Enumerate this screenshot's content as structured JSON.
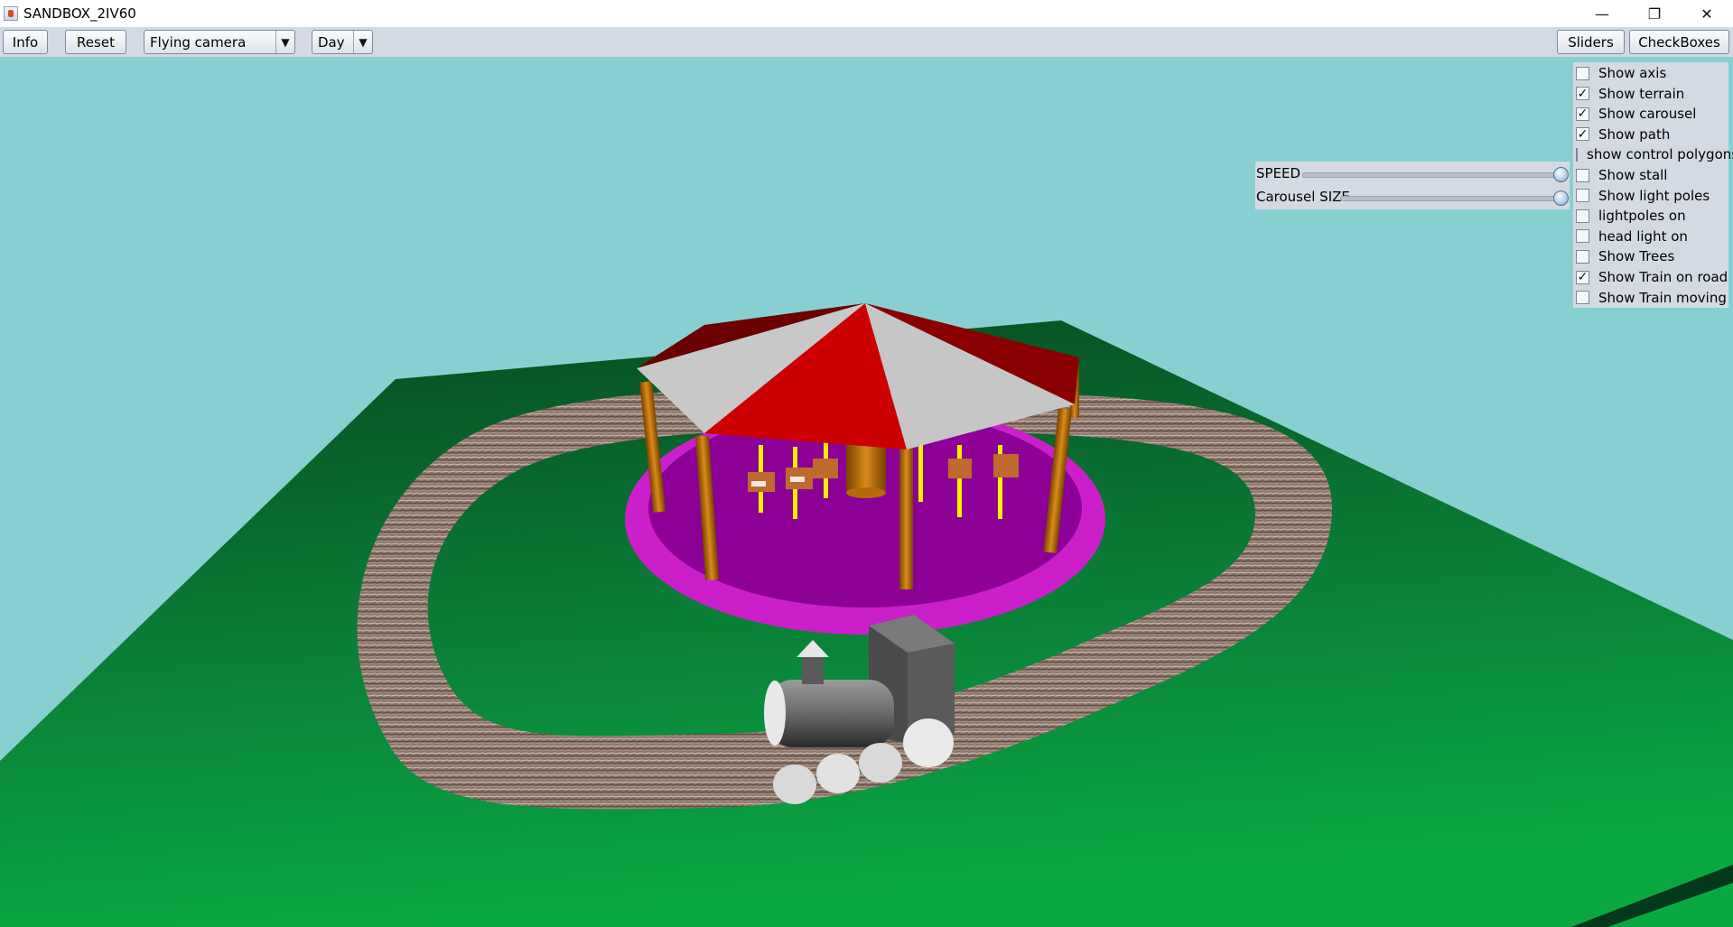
{
  "window": {
    "title": "SANDBOX_2IV60",
    "minimize_glyph": "—",
    "maximize_glyph": "❐",
    "close_glyph": "✕"
  },
  "toolbar": {
    "info_label": "Info",
    "reset_label": "Reset",
    "camera_mode": "Flying camera",
    "time_of_day": "Day",
    "sliders_label": "Sliders",
    "checkboxes_label": "CheckBoxes",
    "dropdown_arrow": "▼"
  },
  "sliders": [
    {
      "label": "SPEED",
      "value": 1.0
    },
    {
      "label": "Carousel SIZE",
      "value": 1.0
    }
  ],
  "checkboxes": [
    {
      "label": "Show axis",
      "checked": false
    },
    {
      "label": "Show terrain",
      "checked": true
    },
    {
      "label": "Show carousel",
      "checked": true
    },
    {
      "label": "Show path",
      "checked": true
    },
    {
      "label": "show control polygons",
      "checked": false
    },
    {
      "label": "Show stall",
      "checked": false
    },
    {
      "label": "Show light poles",
      "checked": false
    },
    {
      "label": "lightpoles on",
      "checked": false
    },
    {
      "label": "head light on",
      "checked": false
    },
    {
      "label": "Show Trees",
      "checked": false
    },
    {
      "label": "Show Train on road",
      "checked": true
    },
    {
      "label": "Show Train moving",
      "checked": false
    }
  ],
  "check_glyph": "✓",
  "colors": {
    "sky": "#87cfd1",
    "terrain": "#0b8a3a",
    "carousel_base": "#cc1fcc",
    "carousel_floor": "#8c0096",
    "roof_red": "#cc0000",
    "roof_grey": "#c8c8c8",
    "pole": "#b8690a",
    "track": "#8a7469",
    "panel_bg": "#d4dae3"
  }
}
